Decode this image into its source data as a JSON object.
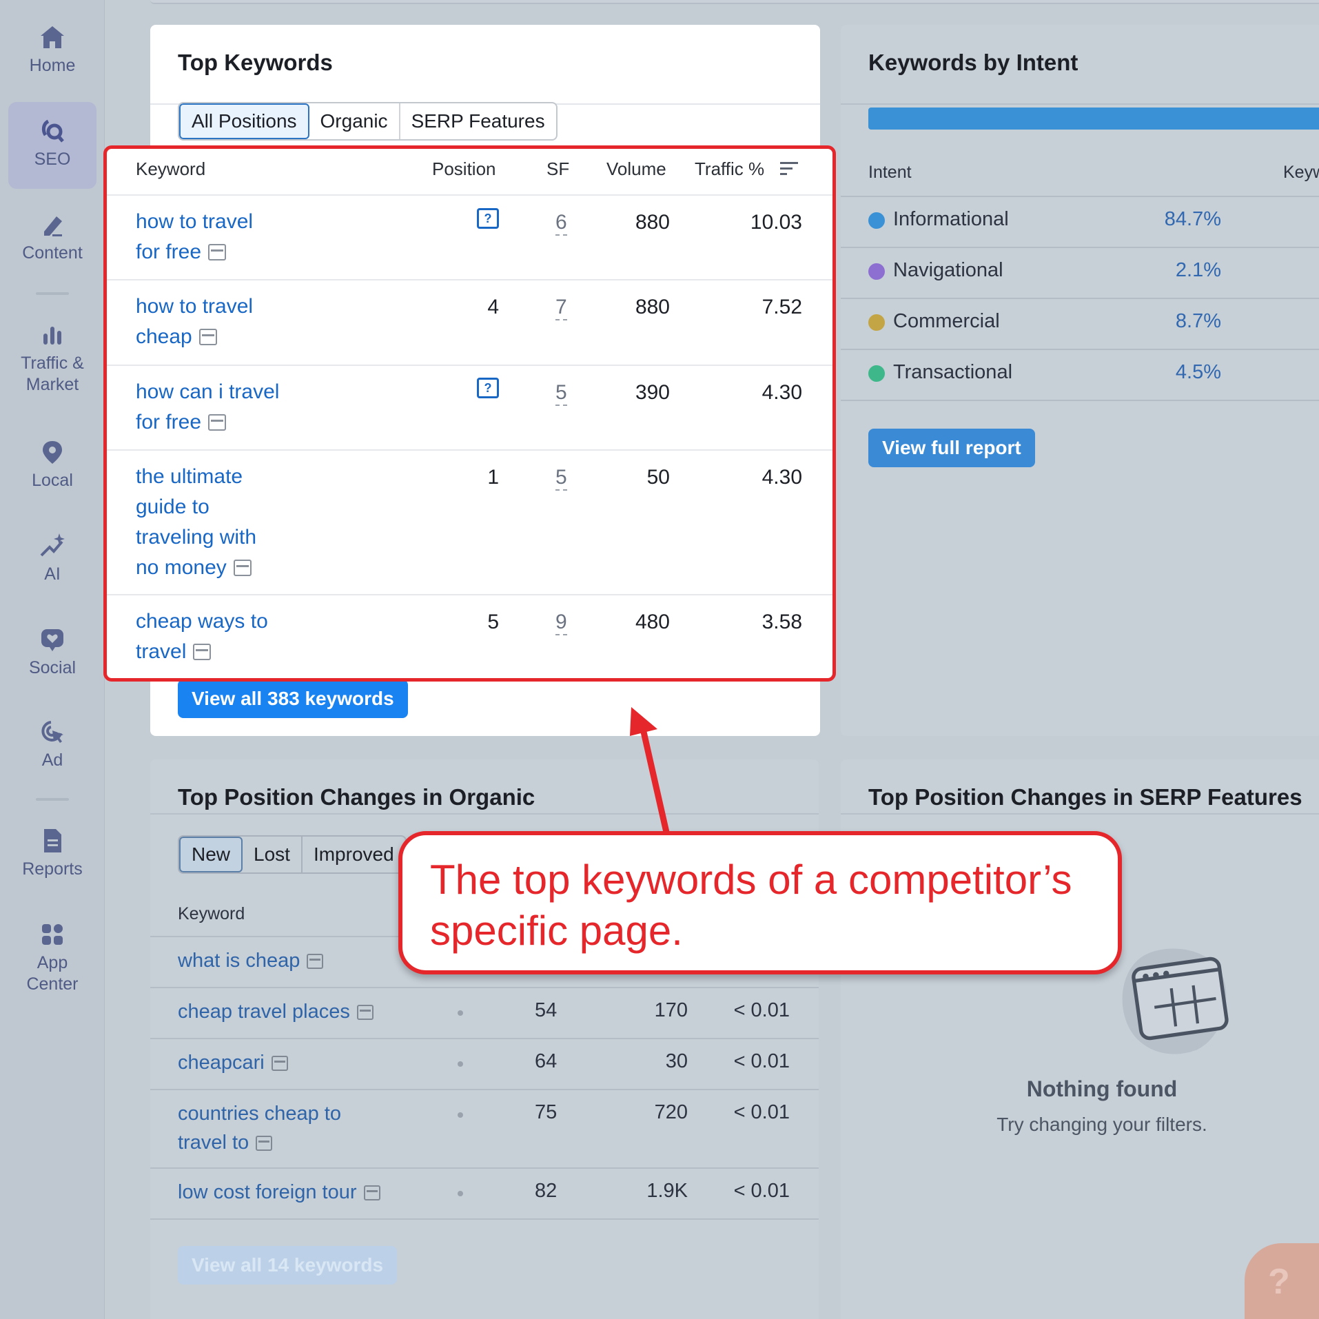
{
  "sidebar": {
    "items": [
      {
        "label": "Home"
      },
      {
        "label": "SEO"
      },
      {
        "label": "Content"
      },
      {
        "label": "Traffic &"
      },
      {
        "label": "Market"
      },
      {
        "label": "Local"
      },
      {
        "label": "AI"
      },
      {
        "label": "Social"
      },
      {
        "label": "Ad"
      },
      {
        "label": "Reports"
      },
      {
        "label": "App"
      },
      {
        "label": "Center"
      }
    ]
  },
  "top_keywords": {
    "title": "Top Keywords",
    "tabs": [
      "All Positions",
      "Organic",
      "SERP Features"
    ],
    "columns": [
      "Keyword",
      "Position",
      "SF",
      "Volume",
      "Traffic %"
    ],
    "rows": [
      {
        "line1": "how to travel",
        "line2": "for free",
        "line3": "",
        "line4": "",
        "position": "",
        "sf": "6",
        "volume": "880",
        "traffic": "10.03"
      },
      {
        "line1": "how to travel",
        "line2": "cheap",
        "line3": "",
        "line4": "",
        "position": "4",
        "sf": "7",
        "volume": "880",
        "traffic": "7.52"
      },
      {
        "line1": "how can i travel",
        "line2": "for free",
        "line3": "",
        "line4": "",
        "position": "",
        "sf": "5",
        "volume": "390",
        "traffic": "4.30"
      },
      {
        "line1": "the ultimate",
        "line2": "guide to",
        "line3": "traveling with",
        "line4": "no money",
        "position": "1",
        "sf": "5",
        "volume": "50",
        "traffic": "4.30"
      },
      {
        "line1": "cheap ways to",
        "line2": "travel",
        "line3": "",
        "line4": "",
        "position": "5",
        "sf": "9",
        "volume": "480",
        "traffic": "3.58"
      }
    ],
    "view_all": "View all 383 keywords"
  },
  "intent": {
    "title": "Keywords by Intent",
    "col_intent": "Intent",
    "col_keywords": "Keyw",
    "rows": [
      {
        "label": "Informational",
        "pct": "84.7%",
        "color": "#3a91d6"
      },
      {
        "label": "Navigational",
        "pct": "2.1%",
        "color": "#8d6fd1"
      },
      {
        "label": "Commercial",
        "pct": "8.7%",
        "color": "#c4a545"
      },
      {
        "label": "Transactional",
        "pct": "4.5%",
        "color": "#3eb88a"
      }
    ],
    "view_full": "View full report"
  },
  "position_changes": {
    "title": "Top Position Changes in Organic",
    "tabs": [
      "New",
      "Lost",
      "Improved"
    ],
    "col_keyword": "Keyword",
    "rows": [
      {
        "line1": "what is cheap",
        "line2": "",
        "pos": "",
        "vol": "",
        "traffic": ""
      },
      {
        "line1": "cheap travel places",
        "line2": "",
        "pos": "54",
        "vol": "170",
        "traffic": "< 0.01"
      },
      {
        "line1": "cheapcari",
        "line2": "",
        "pos": "64",
        "vol": "30",
        "traffic": "< 0.01"
      },
      {
        "line1": "countries cheap to",
        "line2": "travel to",
        "pos": "75",
        "vol": "720",
        "traffic": "< 0.01"
      },
      {
        "line1": "low cost foreign tour",
        "line2": "",
        "pos": "82",
        "vol": "1.9K",
        "traffic": "< 0.01"
      }
    ],
    "view_all": "View all 14 keywords"
  },
  "serp_changes": {
    "title": "Top Position Changes in SERP Features",
    "empty_title": "Nothing found",
    "empty_sub": "Try changing your filters."
  },
  "callout": {
    "line1": "The top keywords of a competitor’s",
    "line2": "specific page."
  },
  "help": {
    "label": "?"
  },
  "colors": {
    "accent": "#1a83f2",
    "highlight": "#e5262a",
    "link": "#1967c5"
  }
}
